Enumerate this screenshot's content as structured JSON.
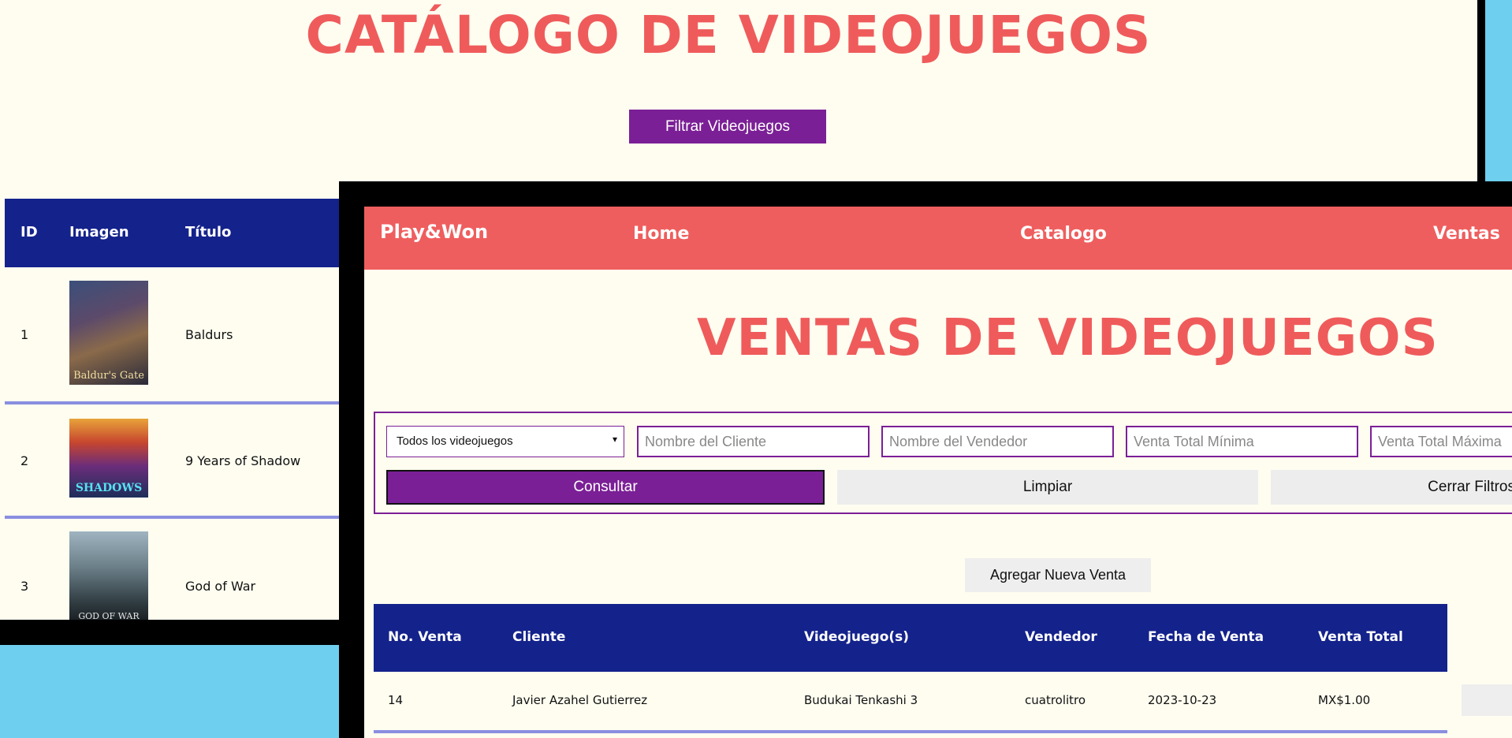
{
  "catalog": {
    "title": "CATÁLOGO DE VIDEOJUEGOS",
    "filter_button": "Filtrar Videojuegos",
    "columns": [
      "ID",
      "Imagen",
      "Título"
    ],
    "rows": [
      {
        "id": "1",
        "title": "Baldurs",
        "cover_text": "Baldur's Gate"
      },
      {
        "id": "2",
        "title": "9 Years of Shadow",
        "cover_text": "SHADOWS"
      },
      {
        "id": "3",
        "title": "God of War",
        "cover_text": "GOD OF WAR"
      }
    ]
  },
  "ventas": {
    "nav": {
      "logo": "Play&Won",
      "links": [
        "Home",
        "Catalogo",
        "Ventas"
      ]
    },
    "title": "VENTAS DE VIDEOJUEGOS",
    "filters": {
      "select_value": "Todos los videojuegos",
      "cliente_placeholder": "Nombre del Cliente",
      "vendedor_placeholder": "Nombre del Vendedor",
      "min_placeholder": "Venta Total Mínima",
      "max_placeholder": "Venta Total Máxima",
      "consultar": "Consultar",
      "limpiar": "Limpiar",
      "cerrar": "Cerrar Filtros"
    },
    "add_button": "Agregar Nueva Venta",
    "table": {
      "columns": [
        "No. Venta",
        "Cliente",
        "Videojuego(s)",
        "Vendedor",
        "Fecha de Venta",
        "Venta Total"
      ],
      "rows": [
        [
          "14",
          "Javier Azahel Gutierrez",
          "Budukai Tenkashi 3",
          "cuatrolitro",
          "2023-10-23",
          "MX$1.00"
        ]
      ]
    }
  },
  "colors": {
    "accent_red": "#ef5b5b",
    "purple": "#7b1f96",
    "navy": "#14228b",
    "cream": "#fefdf0",
    "sky": "#6ecfee"
  }
}
